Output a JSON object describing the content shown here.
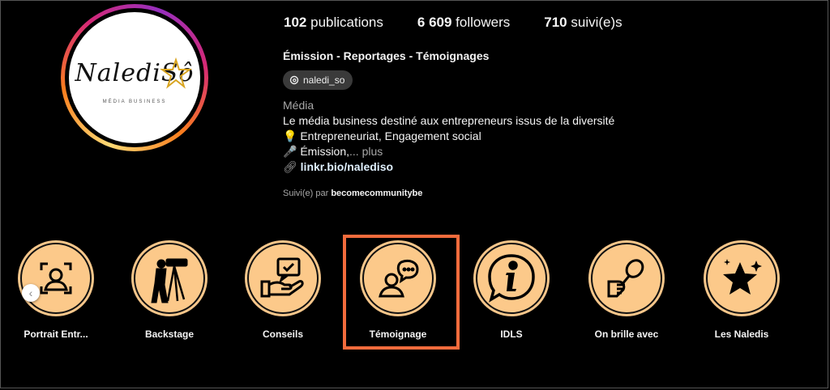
{
  "profile": {
    "stats": {
      "posts_count": "102",
      "posts_label": "publications",
      "followers_count": "6 609",
      "followers_label": "followers",
      "following_count": "710",
      "following_label": "suivi(e)s"
    },
    "display_name": "Émission - Reportages - Témoignages",
    "threads_handle": "naledi_so",
    "category": "Média",
    "bio_line1": "Le média business destiné aux entrepreneurs issus de la diversité",
    "bio_line2_emoji": "💡",
    "bio_line2": "Entrepreneuriat, Engagement social",
    "bio_line3_emoji": "🎤",
    "bio_line3": "Émission,",
    "bio_more": "... plus",
    "link": "linkr.bio/nalediso",
    "followed_by_prefix": "Suivi(e) par",
    "followed_by_user": "becomecommunitybe",
    "avatar": {
      "logo_text": "NalediSô",
      "logo_subtitle": "MÉDIA BUSINESS"
    }
  },
  "highlights": [
    {
      "label": "Portrait Entr...",
      "icon": "portrait-scan-icon"
    },
    {
      "label": "Backstage",
      "icon": "camera-operator-icon"
    },
    {
      "label": "Conseils",
      "icon": "hand-message-icon"
    },
    {
      "label": "Témoignage",
      "icon": "person-speech-bubble-icon"
    },
    {
      "label": "IDLS",
      "icon": "info-bubble-icon"
    },
    {
      "label": "On brille avec",
      "icon": "microphone-hand-icon"
    },
    {
      "label": "Les Naledis",
      "icon": "star-sparkle-icon"
    }
  ],
  "colors": {
    "highlight_fill": "#fcc98a",
    "selection_box": "#f26b3c",
    "link": "#e0f1ff"
  }
}
